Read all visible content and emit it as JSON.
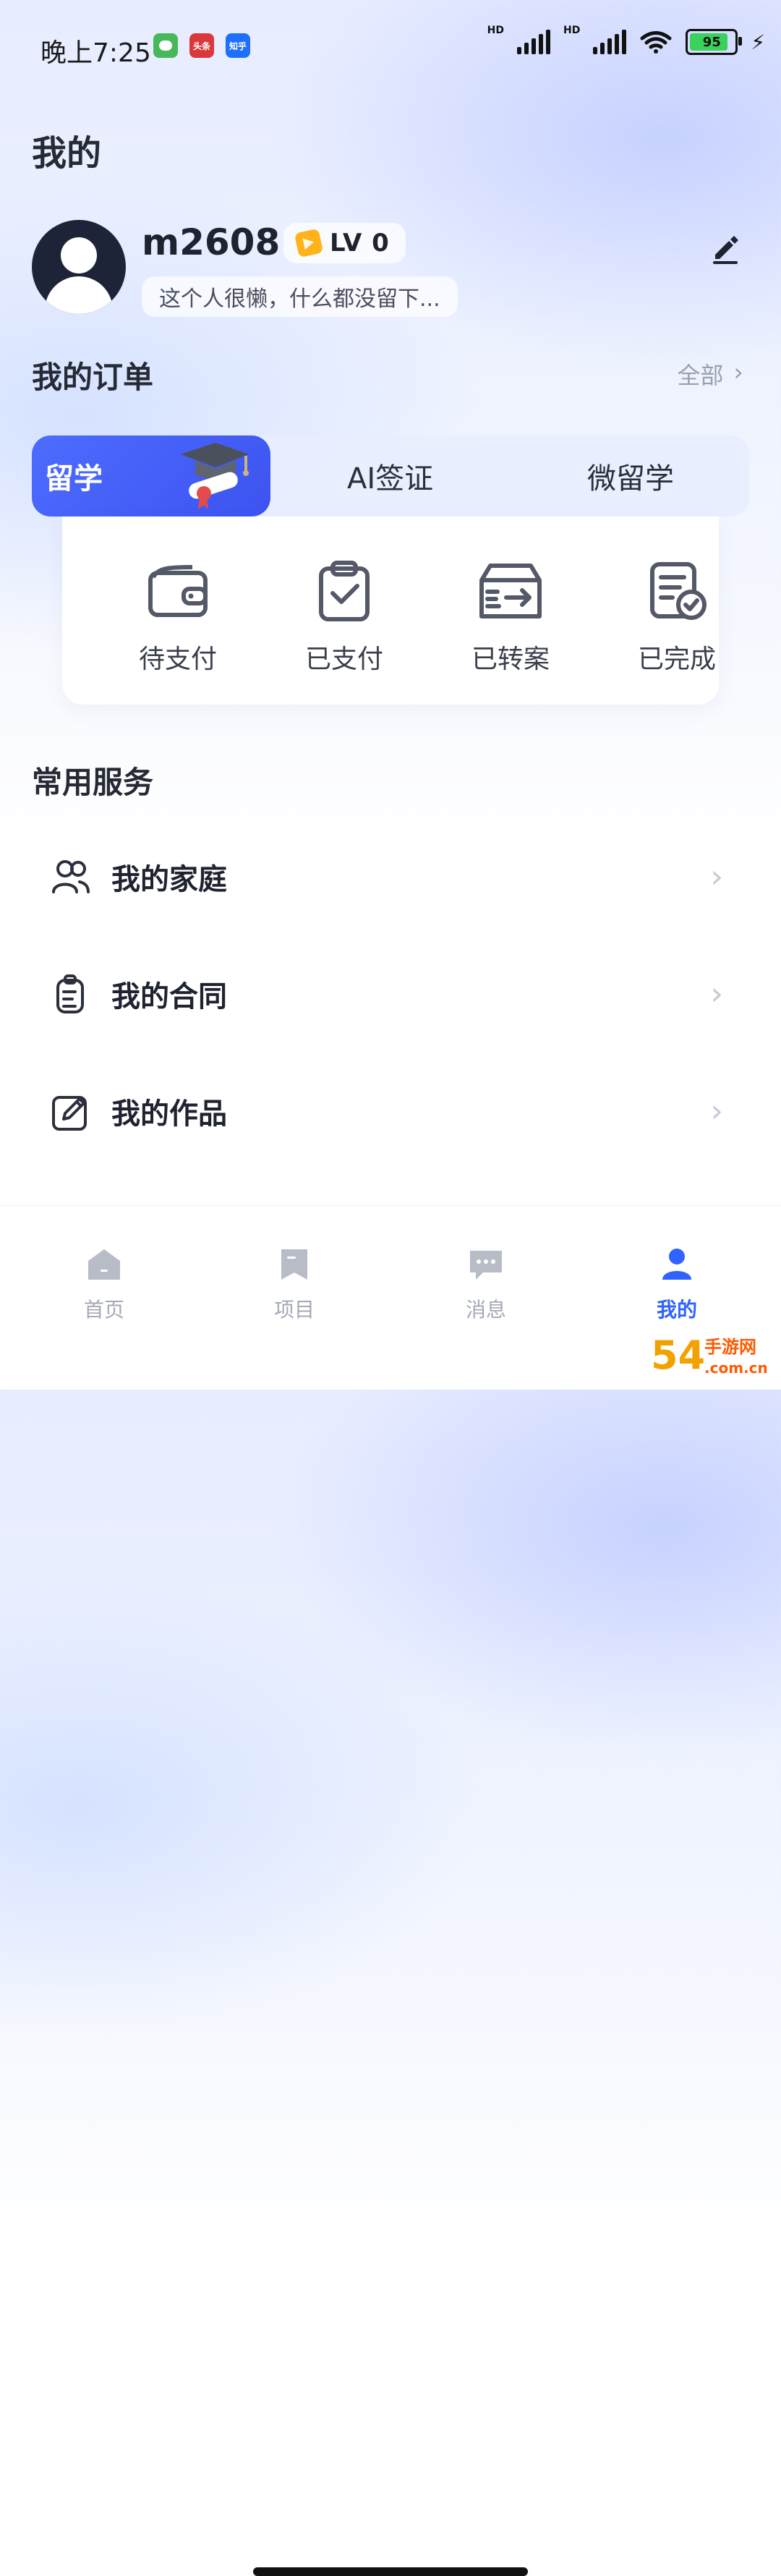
{
  "status_bar": {
    "time": "晚上7:25",
    "apps": [
      {
        "name": "cat-app-icon",
        "color": "#48b85a",
        "label": ""
      },
      {
        "name": "toutiao-app-icon",
        "color": "#d9393b",
        "label": "头条"
      },
      {
        "name": "zhihu-app-icon",
        "color": "#1f6fff",
        "label": "知乎"
      }
    ],
    "hd_label": "HD",
    "battery_percent": "95",
    "battery_level": 0.95
  },
  "header": {
    "title": "我的"
  },
  "profile": {
    "username": "m2608",
    "level_label": "LV 0",
    "bio": "这个人很懒，什么都没留下..."
  },
  "orders": {
    "title": "我的订单",
    "view_all": "全部",
    "tabs": [
      {
        "label": "留学",
        "active": true
      },
      {
        "label": "AI签证",
        "active": false
      },
      {
        "label": "微留学",
        "active": false
      }
    ],
    "statuses": [
      {
        "label": "待支付",
        "icon": "wallet-icon"
      },
      {
        "label": "已支付",
        "icon": "clipboard-check-icon"
      },
      {
        "label": "已转案",
        "icon": "transfer-box-icon"
      },
      {
        "label": "已完成",
        "icon": "document-check-icon"
      }
    ]
  },
  "services": {
    "title": "常用服务",
    "items": [
      {
        "label": "我的家庭",
        "icon": "family-icon"
      },
      {
        "label": "我的合同",
        "icon": "contract-icon"
      },
      {
        "label": "我的作品",
        "icon": "edit-work-icon"
      }
    ]
  },
  "bottom_nav": {
    "items": [
      {
        "label": "首页",
        "icon": "home-icon",
        "active": false
      },
      {
        "label": "项目",
        "icon": "bookmark-icon",
        "active": false
      },
      {
        "label": "消息",
        "icon": "message-icon",
        "active": false
      },
      {
        "label": "我的",
        "icon": "user-icon",
        "active": true
      }
    ],
    "active_color": "#2f62ff",
    "inactive_color": "#a4a9b5"
  },
  "watermark": {
    "text_main": "54",
    "text_site": "手游网",
    "text_domain": ".com.cn"
  }
}
